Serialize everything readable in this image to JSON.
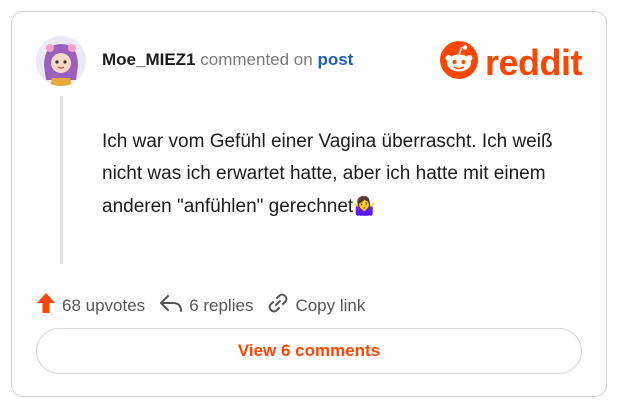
{
  "comment": {
    "username": "Moe_MIEZ1",
    "commented_on_text": "commented on",
    "post_link": "post",
    "body": "Ich war vom Gefühl einer Vagina überrascht. Ich weiß nicht was ich erwartet hatte, aber ich hatte mit einem anderen \"anfühlen\" gerechnet",
    "emoji": "🤷‍♀️"
  },
  "brand": {
    "name": "reddit",
    "color": "#ff4500"
  },
  "actions": {
    "upvotes": "68 upvotes",
    "replies": "6 replies",
    "copy_link": "Copy link"
  },
  "view_button": "View 6 comments",
  "icons": [
    "reddit-logo-icon",
    "upvote-arrow-icon",
    "reply-icon",
    "link-icon"
  ]
}
